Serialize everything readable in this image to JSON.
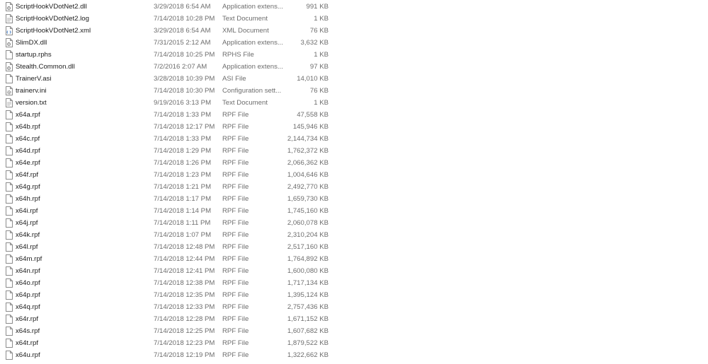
{
  "files": [
    {
      "name": "ScriptHookVDotNet2.dll",
      "date": "3/29/2018 6:54 AM",
      "type": "Application extens...",
      "size": "991 KB",
      "icon": "dll-file-icon"
    },
    {
      "name": "ScriptHookVDotNet2.log",
      "date": "7/14/2018 10:28 PM",
      "type": "Text Document",
      "size": "1 KB",
      "icon": "text-file-icon"
    },
    {
      "name": "ScriptHookVDotNet2.xml",
      "date": "3/29/2018 6:54 AM",
      "type": "XML Document",
      "size": "76 KB",
      "icon": "xml-file-icon"
    },
    {
      "name": "SlimDX.dll",
      "date": "7/31/2015 2:12 AM",
      "type": "Application extens...",
      "size": "3,632 KB",
      "icon": "dll-file-icon"
    },
    {
      "name": "startup.rphs",
      "date": "7/14/2018 10:25 PM",
      "type": "RPHS File",
      "size": "1 KB",
      "icon": "generic-file-icon"
    },
    {
      "name": "Stealth.Common.dll",
      "date": "7/2/2016 2:07 AM",
      "type": "Application extens...",
      "size": "97 KB",
      "icon": "dll-file-icon"
    },
    {
      "name": "TrainerV.asi",
      "date": "3/28/2018 10:39 PM",
      "type": "ASI File",
      "size": "14,010 KB",
      "icon": "generic-file-icon"
    },
    {
      "name": "trainerv.ini",
      "date": "7/14/2018 10:30 PM",
      "type": "Configuration sett...",
      "size": "76 KB",
      "icon": "config-file-icon"
    },
    {
      "name": "version.txt",
      "date": "9/19/2016 3:13 PM",
      "type": "Text Document",
      "size": "1 KB",
      "icon": "text-file-icon"
    },
    {
      "name": "x64a.rpf",
      "date": "7/14/2018 1:33 PM",
      "type": "RPF File",
      "size": "47,558 KB",
      "icon": "generic-file-icon"
    },
    {
      "name": "x64b.rpf",
      "date": "7/14/2018 12:17 PM",
      "type": "RPF File",
      "size": "145,946 KB",
      "icon": "generic-file-icon"
    },
    {
      "name": "x64c.rpf",
      "date": "7/14/2018 1:33 PM",
      "type": "RPF File",
      "size": "2,144,734 KB",
      "icon": "generic-file-icon"
    },
    {
      "name": "x64d.rpf",
      "date": "7/14/2018 1:29 PM",
      "type": "RPF File",
      "size": "1,762,372 KB",
      "icon": "generic-file-icon"
    },
    {
      "name": "x64e.rpf",
      "date": "7/14/2018 1:26 PM",
      "type": "RPF File",
      "size": "2,066,362 KB",
      "icon": "generic-file-icon"
    },
    {
      "name": "x64f.rpf",
      "date": "7/14/2018 1:23 PM",
      "type": "RPF File",
      "size": "1,004,646 KB",
      "icon": "generic-file-icon"
    },
    {
      "name": "x64g.rpf",
      "date": "7/14/2018 1:21 PM",
      "type": "RPF File",
      "size": "2,492,770 KB",
      "icon": "generic-file-icon"
    },
    {
      "name": "x64h.rpf",
      "date": "7/14/2018 1:17 PM",
      "type": "RPF File",
      "size": "1,659,730 KB",
      "icon": "generic-file-icon"
    },
    {
      "name": "x64i.rpf",
      "date": "7/14/2018 1:14 PM",
      "type": "RPF File",
      "size": "1,745,160 KB",
      "icon": "generic-file-icon"
    },
    {
      "name": "x64j.rpf",
      "date": "7/14/2018 1:11 PM",
      "type": "RPF File",
      "size": "2,060,078 KB",
      "icon": "generic-file-icon"
    },
    {
      "name": "x64k.rpf",
      "date": "7/14/2018 1:07 PM",
      "type": "RPF File",
      "size": "2,310,204 KB",
      "icon": "generic-file-icon"
    },
    {
      "name": "x64l.rpf",
      "date": "7/14/2018 12:48 PM",
      "type": "RPF File",
      "size": "2,517,160 KB",
      "icon": "generic-file-icon"
    },
    {
      "name": "x64m.rpf",
      "date": "7/14/2018 12:44 PM",
      "type": "RPF File",
      "size": "1,764,892 KB",
      "icon": "generic-file-icon"
    },
    {
      "name": "x64n.rpf",
      "date": "7/14/2018 12:41 PM",
      "type": "RPF File",
      "size": "1,600,080 KB",
      "icon": "generic-file-icon"
    },
    {
      "name": "x64o.rpf",
      "date": "7/14/2018 12:38 PM",
      "type": "RPF File",
      "size": "1,717,134 KB",
      "icon": "generic-file-icon"
    },
    {
      "name": "x64p.rpf",
      "date": "7/14/2018 12:35 PM",
      "type": "RPF File",
      "size": "1,395,124 KB",
      "icon": "generic-file-icon"
    },
    {
      "name": "x64q.rpf",
      "date": "7/14/2018 12:33 PM",
      "type": "RPF File",
      "size": "2,757,436 KB",
      "icon": "generic-file-icon"
    },
    {
      "name": "x64r.rpf",
      "date": "7/14/2018 12:28 PM",
      "type": "RPF File",
      "size": "1,671,152 KB",
      "icon": "generic-file-icon"
    },
    {
      "name": "x64s.rpf",
      "date": "7/14/2018 12:25 PM",
      "type": "RPF File",
      "size": "1,607,682 KB",
      "icon": "generic-file-icon"
    },
    {
      "name": "x64t.rpf",
      "date": "7/14/2018 12:23 PM",
      "type": "RPF File",
      "size": "1,879,522 KB",
      "icon": "generic-file-icon"
    },
    {
      "name": "x64u.rpf",
      "date": "7/14/2018 12:19 PM",
      "type": "RPF File",
      "size": "1,322,662 KB",
      "icon": "generic-file-icon"
    }
  ]
}
